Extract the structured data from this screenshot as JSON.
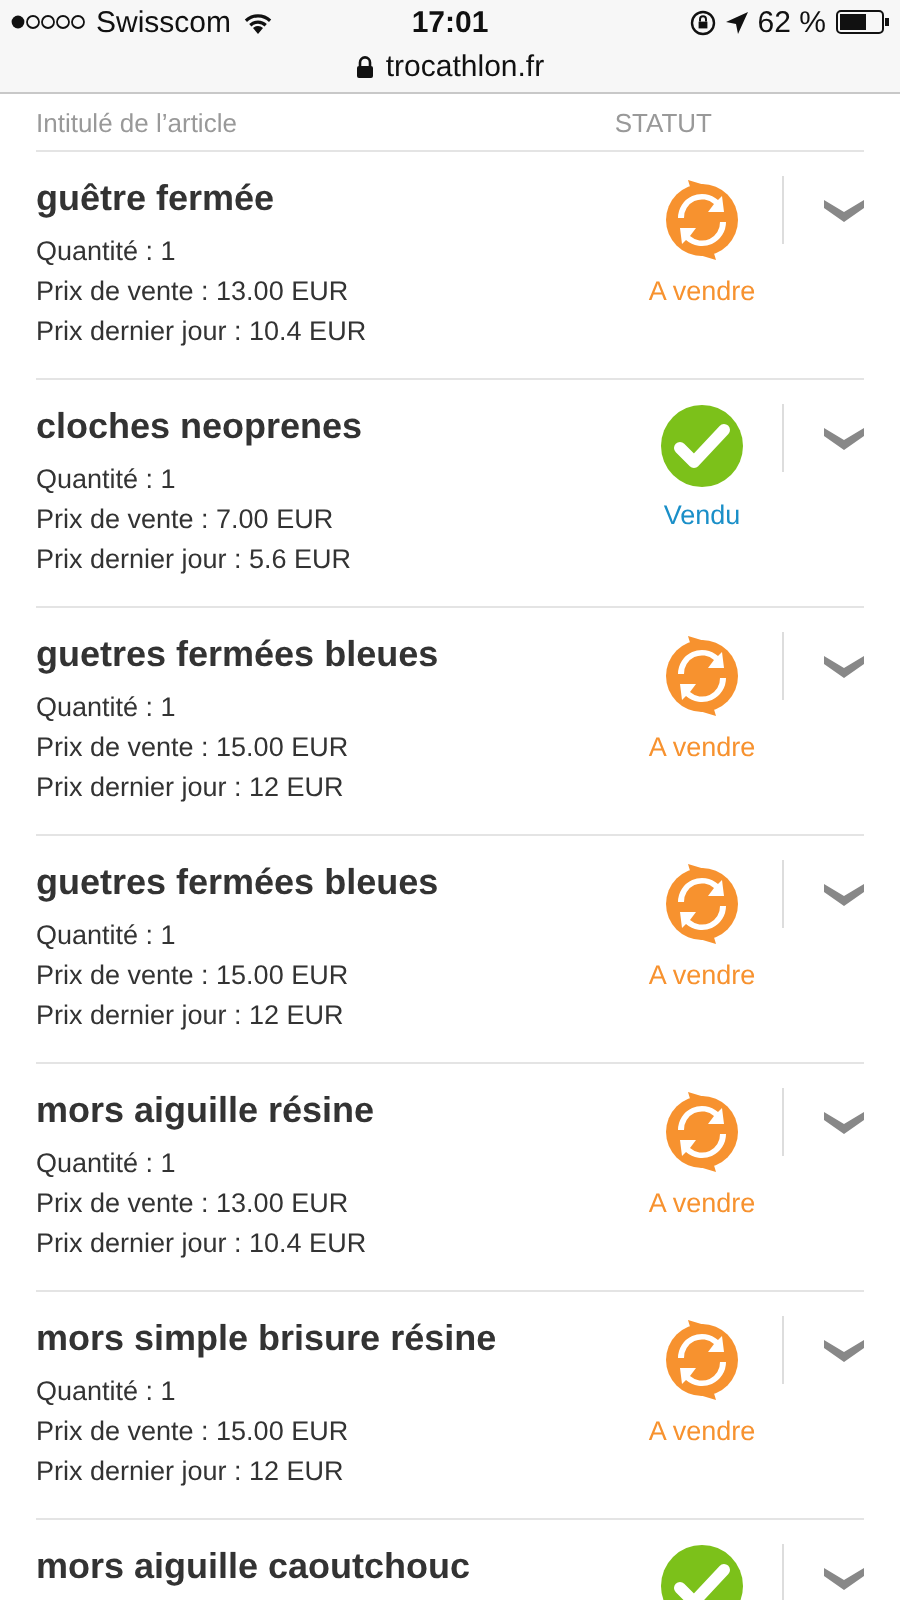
{
  "status_bar": {
    "carrier": "Swisscom",
    "time": "17:01",
    "battery": "62 %"
  },
  "address_bar": {
    "url": "trocathlon.fr"
  },
  "table": {
    "columns": [
      "Intitulé de l’article",
      "STATUT"
    ],
    "rows": [
      {
        "name": "guêtre fermée",
        "quantity": "Quantité : 1",
        "price": "Prix de vente : 13.00 EUR",
        "last_day_price": "Prix dernier jour : 10.4 EUR",
        "status": {
          "kind": "for_sale",
          "label": "A vendre"
        }
      },
      {
        "name": "cloches neoprenes",
        "quantity": "Quantité : 1",
        "price": "Prix de vente : 7.00 EUR",
        "last_day_price": "Prix dernier jour : 5.6 EUR",
        "status": {
          "kind": "sold",
          "label": "Vendu"
        }
      },
      {
        "name": "guetres fermées bleues",
        "quantity": "Quantité : 1",
        "price": "Prix de vente : 15.00 EUR",
        "last_day_price": "Prix dernier jour : 12 EUR",
        "status": {
          "kind": "for_sale",
          "label": "A vendre"
        }
      },
      {
        "name": "guetres fermées bleues",
        "quantity": "Quantité : 1",
        "price": "Prix de vente : 15.00 EUR",
        "last_day_price": "Prix dernier jour : 12 EUR",
        "status": {
          "kind": "for_sale",
          "label": "A vendre"
        }
      },
      {
        "name": "mors aiguille résine",
        "quantity": "Quantité : 1",
        "price": "Prix de vente : 13.00 EUR",
        "last_day_price": "Prix dernier jour : 10.4 EUR",
        "status": {
          "kind": "for_sale",
          "label": "A vendre"
        }
      },
      {
        "name": "mors simple brisure résine",
        "quantity": "Quantité : 1",
        "price": "Prix de vente : 15.00 EUR",
        "last_day_price": "Prix dernier jour : 12 EUR",
        "status": {
          "kind": "for_sale",
          "label": "A vendre"
        }
      },
      {
        "name": "mors aiguille caoutchouc",
        "status": {
          "kind": "sold"
        }
      }
    ]
  }
}
